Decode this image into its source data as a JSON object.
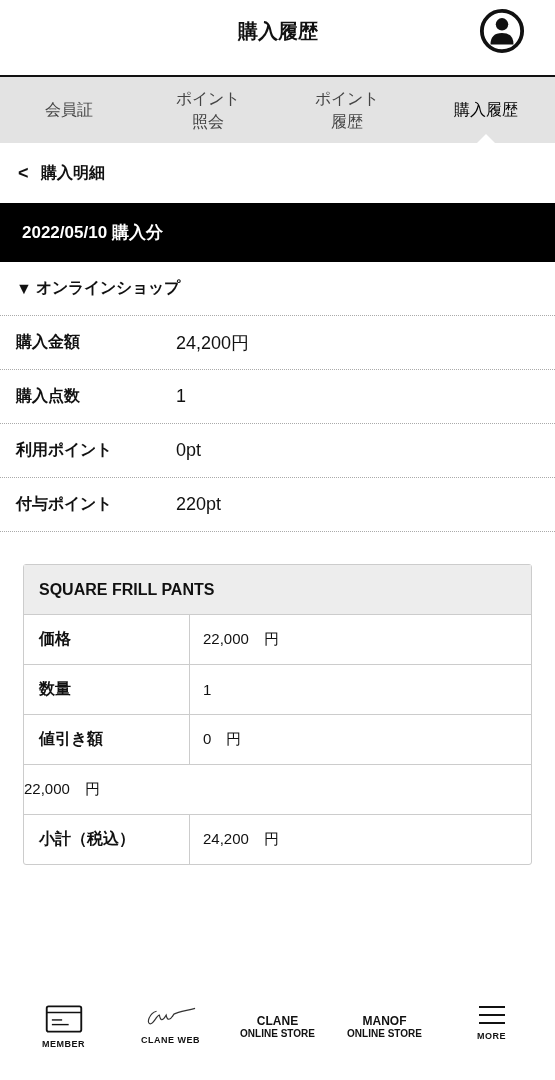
{
  "header": {
    "title": "購入履歴"
  },
  "tabs": [
    {
      "label": "会員証",
      "selected": false
    },
    {
      "label": "ポイント照会",
      "selected": false
    },
    {
      "label": "ポイント履歴",
      "selected": false
    },
    {
      "label": "購入履歴",
      "selected": true
    }
  ],
  "back": {
    "icon": "<",
    "label": "購入明細"
  },
  "date_bar": "2022/05/10 購入分",
  "section": {
    "marker": "▼",
    "title": "オンラインショップ"
  },
  "summary": [
    {
      "label": "購入金額",
      "value": "24,200円"
    },
    {
      "label": "購入点数",
      "value": "1"
    },
    {
      "label": "利用ポイント",
      "value": "0pt"
    },
    {
      "label": "付与ポイント",
      "value": "220pt"
    }
  ],
  "item_table": {
    "title": "SQUARE FRILL PANTS",
    "rows": [
      {
        "kind": "pair",
        "label": "価格",
        "value": "22,000　円"
      },
      {
        "kind": "pair",
        "label": "数量",
        "value": "1"
      },
      {
        "kind": "pair",
        "label": "値引き額",
        "value": "0　円"
      },
      {
        "kind": "single",
        "value": "22,000　円"
      },
      {
        "kind": "pair",
        "label": "小計（税込）",
        "value": "24,200　円"
      }
    ]
  },
  "bottom_nav": [
    {
      "kind": "card",
      "label": "MEMBER"
    },
    {
      "kind": "signature",
      "label": "CLANE WEB"
    },
    {
      "kind": "logo",
      "label": "CLANE",
      "sub": "ONLINE STORE"
    },
    {
      "kind": "logo",
      "label": "MANOF",
      "sub": "ONLINE STORE"
    },
    {
      "kind": "menu",
      "label": "MORE"
    }
  ]
}
